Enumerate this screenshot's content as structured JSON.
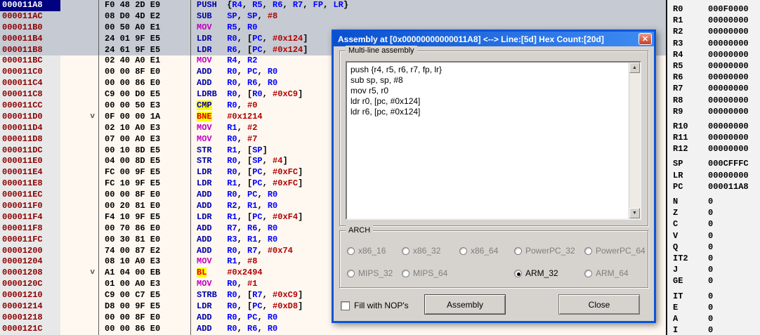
{
  "colors": {
    "code_background": "#FFF8F0",
    "gutter_background": "#E8E8E8",
    "selection": "#C6CAD2",
    "current_address_bg": "#000080",
    "address_text": "#8A0000",
    "mnemonic": "#0000A8",
    "mnemonic_mov": "#C000C0",
    "register": "#0000FF",
    "immediate": "#B00000",
    "highlight_yellow": "#FFFF00",
    "branch_text": "#E00000",
    "titlebar_blue": "#0A50CF"
  },
  "disasm": {
    "rows": [
      {
        "addr": "000011A8",
        "bytes": "F0 48 2D E9",
        "sel": true,
        "cur": true,
        "ins": [
          [
            "PUSH",
            "m"
          ],
          [
            "  {",
            "p"
          ],
          [
            "R4",
            "r"
          ],
          [
            ", ",
            "p"
          ],
          [
            "R5",
            "r"
          ],
          [
            ", ",
            "p"
          ],
          [
            "R6",
            "r"
          ],
          [
            ", ",
            "p"
          ],
          [
            "R7",
            "r"
          ],
          [
            ", ",
            "p"
          ],
          [
            "FP",
            "r"
          ],
          [
            ", ",
            "p"
          ],
          [
            "LR",
            "r"
          ],
          [
            "}",
            "p"
          ]
        ]
      },
      {
        "addr": "000011AC",
        "bytes": "08 D0 4D E2",
        "sel": true,
        "ins": [
          [
            "SUB",
            "m"
          ],
          [
            "   ",
            "p"
          ],
          [
            "SP",
            "r"
          ],
          [
            ", ",
            "p"
          ],
          [
            "SP",
            "r"
          ],
          [
            ", ",
            "p"
          ],
          [
            "#8",
            "n"
          ]
        ]
      },
      {
        "addr": "000011B0",
        "bytes": "00 50 A0 E1",
        "sel": true,
        "ins": [
          [
            "MOV",
            "mv"
          ],
          [
            "   ",
            "p"
          ],
          [
            "R5",
            "r"
          ],
          [
            ", ",
            "p"
          ],
          [
            "R0",
            "r"
          ]
        ]
      },
      {
        "addr": "000011B4",
        "bytes": "24 01 9F E5",
        "sel": true,
        "ins": [
          [
            "LDR",
            "m"
          ],
          [
            "   ",
            "p"
          ],
          [
            "R0",
            "r"
          ],
          [
            ", [",
            "p"
          ],
          [
            "PC",
            "r"
          ],
          [
            ", ",
            "p"
          ],
          [
            "#0x124",
            "n"
          ],
          [
            "]",
            "p"
          ]
        ]
      },
      {
        "addr": "000011B8",
        "bytes": "24 61 9F E5",
        "sel": true,
        "ins": [
          [
            "LDR",
            "m"
          ],
          [
            "   ",
            "p"
          ],
          [
            "R6",
            "r"
          ],
          [
            ", [",
            "p"
          ],
          [
            "PC",
            "r"
          ],
          [
            ", ",
            "p"
          ],
          [
            "#0x124",
            "n"
          ],
          [
            "]",
            "p"
          ]
        ]
      },
      {
        "addr": "000011BC",
        "bytes": "02 40 A0 E1",
        "ins": [
          [
            "MOV",
            "mv"
          ],
          [
            "   ",
            "p"
          ],
          [
            "R4",
            "r"
          ],
          [
            ", ",
            "p"
          ],
          [
            "R2",
            "r"
          ]
        ]
      },
      {
        "addr": "000011C0",
        "bytes": "00 00 8F E0",
        "ins": [
          [
            "ADD",
            "m"
          ],
          [
            "   ",
            "p"
          ],
          [
            "R0",
            "r"
          ],
          [
            ", ",
            "p"
          ],
          [
            "PC",
            "r"
          ],
          [
            ", ",
            "p"
          ],
          [
            "R0",
            "r"
          ]
        ]
      },
      {
        "addr": "000011C4",
        "bytes": "00 00 86 E0",
        "ins": [
          [
            "ADD",
            "m"
          ],
          [
            "   ",
            "p"
          ],
          [
            "R0",
            "r"
          ],
          [
            ", ",
            "p"
          ],
          [
            "R6",
            "r"
          ],
          [
            ", ",
            "p"
          ],
          [
            "R0",
            "r"
          ]
        ]
      },
      {
        "addr": "000011C8",
        "bytes": "C9 00 D0 E5",
        "ins": [
          [
            "LDRB",
            "m"
          ],
          [
            "  ",
            "p"
          ],
          [
            "R0",
            "r"
          ],
          [
            ", [",
            "p"
          ],
          [
            "R0",
            "r"
          ],
          [
            ", ",
            "p"
          ],
          [
            "#0xC9",
            "n"
          ],
          [
            "]",
            "p"
          ]
        ]
      },
      {
        "addr": "000011CC",
        "bytes": "00 00 50 E3",
        "ins": [
          [
            "CMP",
            "hc"
          ],
          [
            "   ",
            "p"
          ],
          [
            "R0",
            "r"
          ],
          [
            ", ",
            "p"
          ],
          [
            "#0",
            "n"
          ]
        ]
      },
      {
        "addr": "000011D0",
        "bytes": "0F 00 00 1A",
        "arrow": "v",
        "ins": [
          [
            "BNE",
            "hb"
          ],
          [
            "   ",
            "p"
          ],
          [
            "#0x1214",
            "n"
          ]
        ]
      },
      {
        "addr": "000011D4",
        "bytes": "02 10 A0 E3",
        "ins": [
          [
            "MOV",
            "mv"
          ],
          [
            "   ",
            "p"
          ],
          [
            "R1",
            "r"
          ],
          [
            ", ",
            "p"
          ],
          [
            "#2",
            "n"
          ]
        ]
      },
      {
        "addr": "000011D8",
        "bytes": "07 00 A0 E3",
        "ins": [
          [
            "MOV",
            "mv"
          ],
          [
            "   ",
            "p"
          ],
          [
            "R0",
            "r"
          ],
          [
            ", ",
            "p"
          ],
          [
            "#7",
            "n"
          ]
        ]
      },
      {
        "addr": "000011DC",
        "bytes": "00 10 8D E5",
        "ins": [
          [
            "STR",
            "m"
          ],
          [
            "   ",
            "p"
          ],
          [
            "R1",
            "r"
          ],
          [
            ", [",
            "p"
          ],
          [
            "SP",
            "r"
          ],
          [
            "]",
            "p"
          ]
        ]
      },
      {
        "addr": "000011E0",
        "bytes": "04 00 8D E5",
        "ins": [
          [
            "STR",
            "m"
          ],
          [
            "   ",
            "p"
          ],
          [
            "R0",
            "r"
          ],
          [
            ", [",
            "p"
          ],
          [
            "SP",
            "r"
          ],
          [
            ", ",
            "p"
          ],
          [
            "#4",
            "n"
          ],
          [
            "]",
            "p"
          ]
        ]
      },
      {
        "addr": "000011E4",
        "bytes": "FC 00 9F E5",
        "ins": [
          [
            "LDR",
            "m"
          ],
          [
            "   ",
            "p"
          ],
          [
            "R0",
            "r"
          ],
          [
            ", [",
            "p"
          ],
          [
            "PC",
            "r"
          ],
          [
            ", ",
            "p"
          ],
          [
            "#0xFC",
            "n"
          ],
          [
            "]",
            "p"
          ]
        ]
      },
      {
        "addr": "000011E8",
        "bytes": "FC 10 9F E5",
        "ins": [
          [
            "LDR",
            "m"
          ],
          [
            "   ",
            "p"
          ],
          [
            "R1",
            "r"
          ],
          [
            ", [",
            "p"
          ],
          [
            "PC",
            "r"
          ],
          [
            ", ",
            "p"
          ],
          [
            "#0xFC",
            "n"
          ],
          [
            "]",
            "p"
          ]
        ]
      },
      {
        "addr": "000011EC",
        "bytes": "00 00 8F E0",
        "ins": [
          [
            "ADD",
            "m"
          ],
          [
            "   ",
            "p"
          ],
          [
            "R0",
            "r"
          ],
          [
            ", ",
            "p"
          ],
          [
            "PC",
            "r"
          ],
          [
            ", ",
            "p"
          ],
          [
            "R0",
            "r"
          ]
        ]
      },
      {
        "addr": "000011F0",
        "bytes": "00 20 81 E0",
        "ins": [
          [
            "ADD",
            "m"
          ],
          [
            "   ",
            "p"
          ],
          [
            "R2",
            "r"
          ],
          [
            ", ",
            "p"
          ],
          [
            "R1",
            "r"
          ],
          [
            ", ",
            "p"
          ],
          [
            "R0",
            "r"
          ]
        ]
      },
      {
        "addr": "000011F4",
        "bytes": "F4 10 9F E5",
        "ins": [
          [
            "LDR",
            "m"
          ],
          [
            "   ",
            "p"
          ],
          [
            "R1",
            "r"
          ],
          [
            ", [",
            "p"
          ],
          [
            "PC",
            "r"
          ],
          [
            ", ",
            "p"
          ],
          [
            "#0xF4",
            "n"
          ],
          [
            "]",
            "p"
          ]
        ]
      },
      {
        "addr": "000011F8",
        "bytes": "00 70 86 E0",
        "ins": [
          [
            "ADD",
            "m"
          ],
          [
            "   ",
            "p"
          ],
          [
            "R7",
            "r"
          ],
          [
            ", ",
            "p"
          ],
          [
            "R6",
            "r"
          ],
          [
            ", ",
            "p"
          ],
          [
            "R0",
            "r"
          ]
        ]
      },
      {
        "addr": "000011FC",
        "bytes": "00 30 81 E0",
        "ins": [
          [
            "ADD",
            "m"
          ],
          [
            "   ",
            "p"
          ],
          [
            "R3",
            "r"
          ],
          [
            ", ",
            "p"
          ],
          [
            "R1",
            "r"
          ],
          [
            ", ",
            "p"
          ],
          [
            "R0",
            "r"
          ]
        ]
      },
      {
        "addr": "00001200",
        "bytes": "74 00 87 E2",
        "ins": [
          [
            "ADD",
            "m"
          ],
          [
            "   ",
            "p"
          ],
          [
            "R0",
            "r"
          ],
          [
            ", ",
            "p"
          ],
          [
            "R7",
            "r"
          ],
          [
            ", ",
            "p"
          ],
          [
            "#0x74",
            "n"
          ]
        ]
      },
      {
        "addr": "00001204",
        "bytes": "08 10 A0 E3",
        "ins": [
          [
            "MOV",
            "mv"
          ],
          [
            "   ",
            "p"
          ],
          [
            "R1",
            "r"
          ],
          [
            ", ",
            "p"
          ],
          [
            "#8",
            "n"
          ]
        ]
      },
      {
        "addr": "00001208",
        "bytes": "A1 04 00 EB",
        "arrow": "v",
        "ins": [
          [
            "BL",
            "hb"
          ],
          [
            "    ",
            "p"
          ],
          [
            "#0x2494",
            "n"
          ]
        ]
      },
      {
        "addr": "0000120C",
        "bytes": "01 00 A0 E3",
        "ins": [
          [
            "MOV",
            "mv"
          ],
          [
            "   ",
            "p"
          ],
          [
            "R0",
            "r"
          ],
          [
            ", ",
            "p"
          ],
          [
            "#1",
            "n"
          ]
        ]
      },
      {
        "addr": "00001210",
        "bytes": "C9 00 C7 E5",
        "ins": [
          [
            "STRB",
            "m"
          ],
          [
            "  ",
            "p"
          ],
          [
            "R0",
            "r"
          ],
          [
            ", [",
            "p"
          ],
          [
            "R7",
            "r"
          ],
          [
            ", ",
            "p"
          ],
          [
            "#0xC9",
            "n"
          ],
          [
            "]",
            "p"
          ]
        ]
      },
      {
        "addr": "00001214",
        "bytes": "D8 00 9F E5",
        "ins": [
          [
            "LDR",
            "m"
          ],
          [
            "   ",
            "p"
          ],
          [
            "R0",
            "r"
          ],
          [
            ", [",
            "p"
          ],
          [
            "PC",
            "r"
          ],
          [
            ", ",
            "p"
          ],
          [
            "#0xD8",
            "n"
          ],
          [
            "]",
            "p"
          ]
        ]
      },
      {
        "addr": "00001218",
        "bytes": "00 00 8F E0",
        "ins": [
          [
            "ADD",
            "m"
          ],
          [
            "   ",
            "p"
          ],
          [
            "R0",
            "r"
          ],
          [
            ", ",
            "p"
          ],
          [
            "PC",
            "r"
          ],
          [
            ", ",
            "p"
          ],
          [
            "R0",
            "r"
          ]
        ]
      },
      {
        "addr": "0000121C",
        "bytes": "00 00 86 E0",
        "ins": [
          [
            "ADD",
            "m"
          ],
          [
            "   ",
            "p"
          ],
          [
            "R0",
            "r"
          ],
          [
            ", ",
            "p"
          ],
          [
            "R6",
            "r"
          ],
          [
            ", ",
            "p"
          ],
          [
            "R0",
            "r"
          ]
        ]
      }
    ]
  },
  "registers": {
    "groups": [
      [
        [
          "R0",
          "000F0000"
        ],
        [
          "R1",
          "00000000"
        ],
        [
          "R2",
          "00000000"
        ],
        [
          "R3",
          "00000000"
        ],
        [
          "R4",
          "00000000"
        ],
        [
          "R5",
          "00000000"
        ],
        [
          "R6",
          "00000000"
        ],
        [
          "R7",
          "00000000"
        ],
        [
          "R8",
          "00000000"
        ],
        [
          "R9",
          "00000000"
        ]
      ],
      [
        [
          "R10",
          "00000000"
        ],
        [
          "R11",
          "00000000"
        ],
        [
          "R12",
          "00000000"
        ]
      ],
      [
        [
          "SP",
          "000CFFFC"
        ],
        [
          "LR",
          "00000000"
        ],
        [
          "PC",
          "000011A8"
        ]
      ],
      [
        [
          "N",
          "0"
        ],
        [
          "Z",
          "0"
        ],
        [
          "C",
          "0"
        ],
        [
          "V",
          "0"
        ],
        [
          "Q",
          "0"
        ],
        [
          "IT2",
          "0"
        ],
        [
          "J",
          "0"
        ],
        [
          "GE",
          "0"
        ]
      ],
      [
        [
          "IT",
          "0"
        ],
        [
          "E",
          "0"
        ],
        [
          "A",
          "0"
        ],
        [
          "I",
          "0"
        ]
      ]
    ]
  },
  "dialog": {
    "title": "Assembly at [0x00000000000011A8] <--> Line:[5d] Hex Count:[20d]",
    "close_glyph": "✕",
    "multiline_label": "Multi-line assembly",
    "textarea_lines": [
      "push {r4, r5, r6, r7, fp, lr}",
      "sub sp, sp, #8",
      "mov r5, r0",
      "ldr r0, [pc, #0x124]",
      "ldr r6, [pc, #0x124]"
    ],
    "scroll_up_glyph": "▲",
    "scroll_down_glyph": "▼",
    "arch": {
      "label": "ARCH",
      "rows": [
        [
          {
            "label": "x86_16",
            "state": "disabled"
          },
          {
            "label": "x86_32",
            "state": "disabled"
          },
          {
            "label": "x86_64",
            "state": "disabled"
          },
          {
            "label": "PowerPC_32",
            "state": "disabled"
          },
          {
            "label": "PowerPC_64",
            "state": "disabled"
          }
        ],
        [
          {
            "label": "MIPS_32",
            "state": "disabled"
          },
          {
            "label": "MIPS_64",
            "state": "disabled"
          },
          null,
          {
            "label": "ARM_32",
            "state": "selected"
          },
          {
            "label": "ARM_64",
            "state": "disabled"
          }
        ]
      ]
    },
    "checkbox_label": "Fill with NOP's",
    "checkbox_checked": false,
    "assembly_button": "Assembly",
    "close_button": "Close"
  }
}
